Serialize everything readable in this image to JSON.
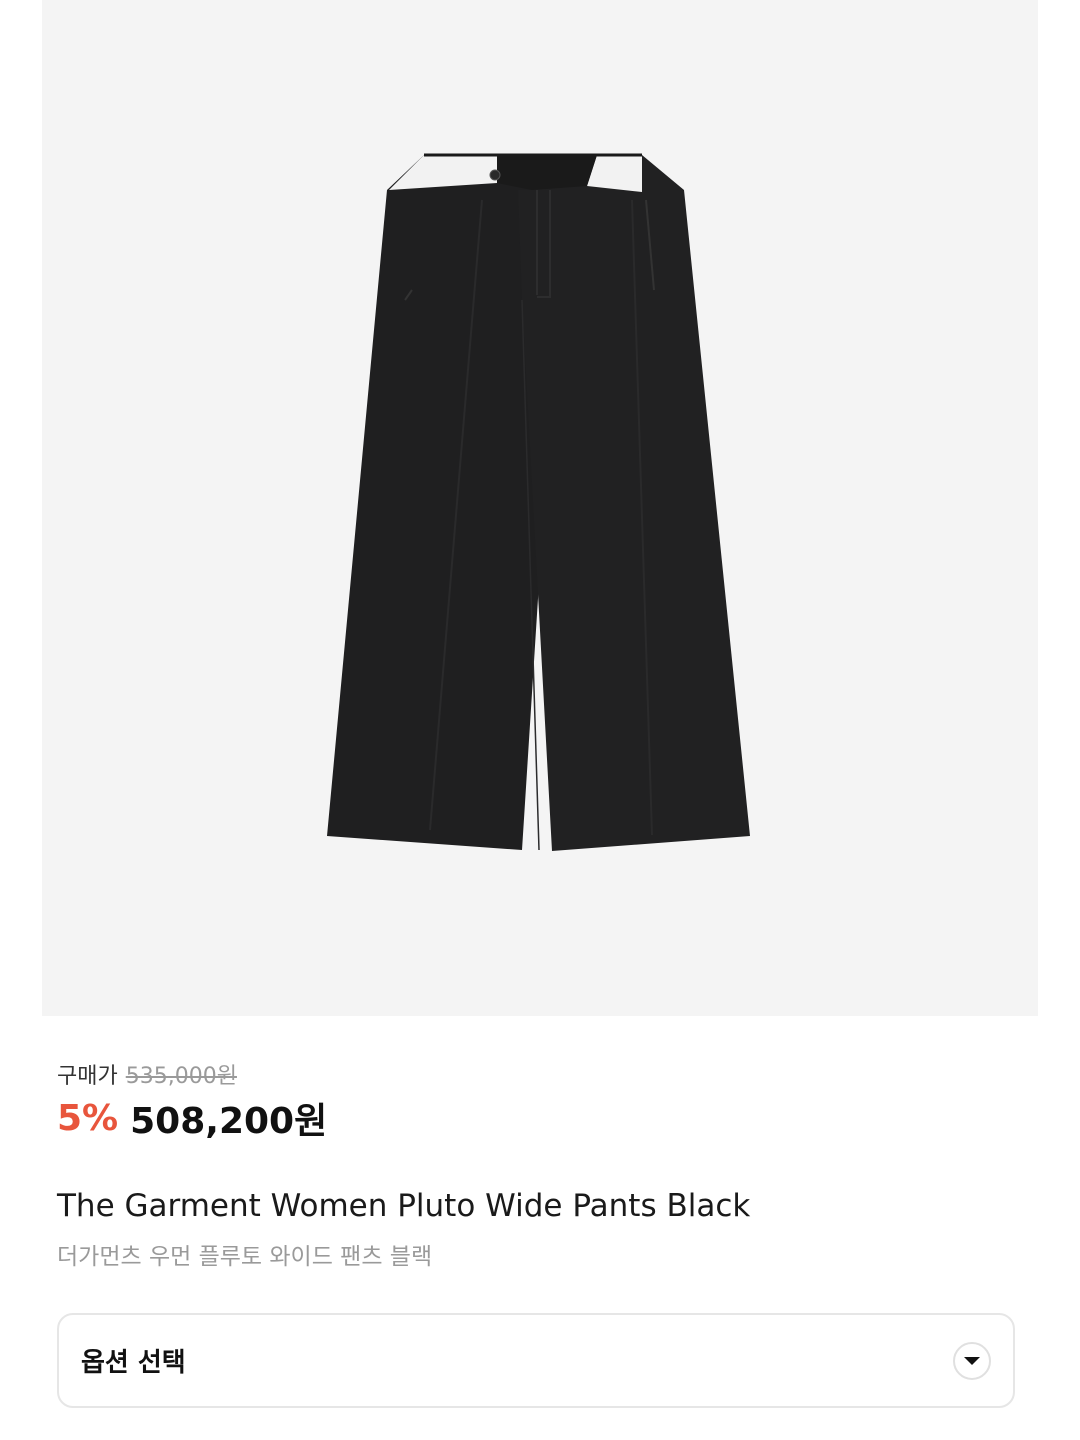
{
  "product": {
    "image_alt": "pants-image",
    "price_label": "구매가",
    "original_price": "535,000원",
    "discount_percent": "5%",
    "sale_price": "508,200원",
    "name_en": "The Garment Women Pluto Wide Pants Black",
    "name_ko": "더가먼츠 우먼 플루토 와이드 팬츠 블랙"
  },
  "option": {
    "label": "옵션 선택",
    "icon": "chevron-down-icon"
  },
  "colors": {
    "discount": "#e8553c",
    "image_bg": "#f4f4f4",
    "muted_text": "#9a9a9a"
  }
}
